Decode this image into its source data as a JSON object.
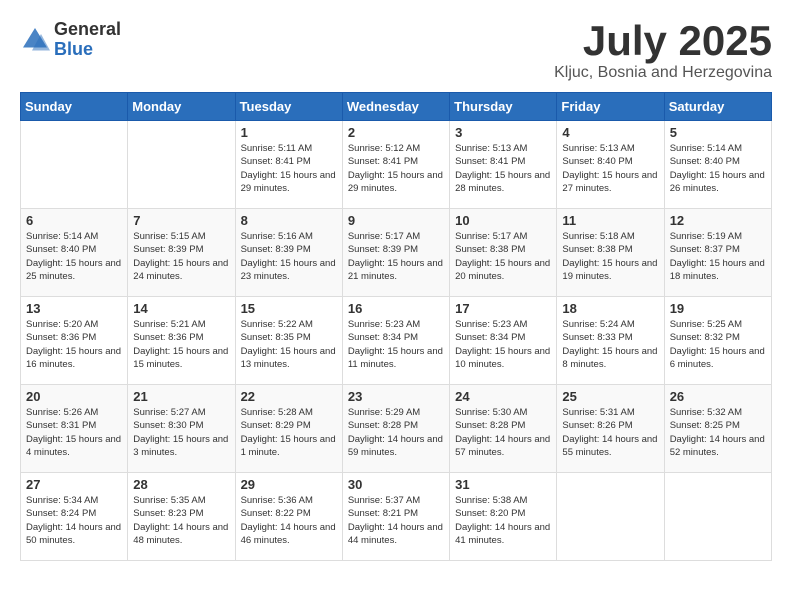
{
  "logo": {
    "general": "General",
    "blue": "Blue"
  },
  "header": {
    "month": "July 2025",
    "location": "Kljuc, Bosnia and Herzegovina"
  },
  "weekdays": [
    "Sunday",
    "Monday",
    "Tuesday",
    "Wednesday",
    "Thursday",
    "Friday",
    "Saturday"
  ],
  "weeks": [
    [
      {
        "day": "",
        "sunrise": "",
        "sunset": "",
        "daylight": ""
      },
      {
        "day": "",
        "sunrise": "",
        "sunset": "",
        "daylight": ""
      },
      {
        "day": "1",
        "sunrise": "Sunrise: 5:11 AM",
        "sunset": "Sunset: 8:41 PM",
        "daylight": "Daylight: 15 hours and 29 minutes."
      },
      {
        "day": "2",
        "sunrise": "Sunrise: 5:12 AM",
        "sunset": "Sunset: 8:41 PM",
        "daylight": "Daylight: 15 hours and 29 minutes."
      },
      {
        "day": "3",
        "sunrise": "Sunrise: 5:13 AM",
        "sunset": "Sunset: 8:41 PM",
        "daylight": "Daylight: 15 hours and 28 minutes."
      },
      {
        "day": "4",
        "sunrise": "Sunrise: 5:13 AM",
        "sunset": "Sunset: 8:40 PM",
        "daylight": "Daylight: 15 hours and 27 minutes."
      },
      {
        "day": "5",
        "sunrise": "Sunrise: 5:14 AM",
        "sunset": "Sunset: 8:40 PM",
        "daylight": "Daylight: 15 hours and 26 minutes."
      }
    ],
    [
      {
        "day": "6",
        "sunrise": "Sunrise: 5:14 AM",
        "sunset": "Sunset: 8:40 PM",
        "daylight": "Daylight: 15 hours and 25 minutes."
      },
      {
        "day": "7",
        "sunrise": "Sunrise: 5:15 AM",
        "sunset": "Sunset: 8:39 PM",
        "daylight": "Daylight: 15 hours and 24 minutes."
      },
      {
        "day": "8",
        "sunrise": "Sunrise: 5:16 AM",
        "sunset": "Sunset: 8:39 PM",
        "daylight": "Daylight: 15 hours and 23 minutes."
      },
      {
        "day": "9",
        "sunrise": "Sunrise: 5:17 AM",
        "sunset": "Sunset: 8:39 PM",
        "daylight": "Daylight: 15 hours and 21 minutes."
      },
      {
        "day": "10",
        "sunrise": "Sunrise: 5:17 AM",
        "sunset": "Sunset: 8:38 PM",
        "daylight": "Daylight: 15 hours and 20 minutes."
      },
      {
        "day": "11",
        "sunrise": "Sunrise: 5:18 AM",
        "sunset": "Sunset: 8:38 PM",
        "daylight": "Daylight: 15 hours and 19 minutes."
      },
      {
        "day": "12",
        "sunrise": "Sunrise: 5:19 AM",
        "sunset": "Sunset: 8:37 PM",
        "daylight": "Daylight: 15 hours and 18 minutes."
      }
    ],
    [
      {
        "day": "13",
        "sunrise": "Sunrise: 5:20 AM",
        "sunset": "Sunset: 8:36 PM",
        "daylight": "Daylight: 15 hours and 16 minutes."
      },
      {
        "day": "14",
        "sunrise": "Sunrise: 5:21 AM",
        "sunset": "Sunset: 8:36 PM",
        "daylight": "Daylight: 15 hours and 15 minutes."
      },
      {
        "day": "15",
        "sunrise": "Sunrise: 5:22 AM",
        "sunset": "Sunset: 8:35 PM",
        "daylight": "Daylight: 15 hours and 13 minutes."
      },
      {
        "day": "16",
        "sunrise": "Sunrise: 5:23 AM",
        "sunset": "Sunset: 8:34 PM",
        "daylight": "Daylight: 15 hours and 11 minutes."
      },
      {
        "day": "17",
        "sunrise": "Sunrise: 5:23 AM",
        "sunset": "Sunset: 8:34 PM",
        "daylight": "Daylight: 15 hours and 10 minutes."
      },
      {
        "day": "18",
        "sunrise": "Sunrise: 5:24 AM",
        "sunset": "Sunset: 8:33 PM",
        "daylight": "Daylight: 15 hours and 8 minutes."
      },
      {
        "day": "19",
        "sunrise": "Sunrise: 5:25 AM",
        "sunset": "Sunset: 8:32 PM",
        "daylight": "Daylight: 15 hours and 6 minutes."
      }
    ],
    [
      {
        "day": "20",
        "sunrise": "Sunrise: 5:26 AM",
        "sunset": "Sunset: 8:31 PM",
        "daylight": "Daylight: 15 hours and 4 minutes."
      },
      {
        "day": "21",
        "sunrise": "Sunrise: 5:27 AM",
        "sunset": "Sunset: 8:30 PM",
        "daylight": "Daylight: 15 hours and 3 minutes."
      },
      {
        "day": "22",
        "sunrise": "Sunrise: 5:28 AM",
        "sunset": "Sunset: 8:29 PM",
        "daylight": "Daylight: 15 hours and 1 minute."
      },
      {
        "day": "23",
        "sunrise": "Sunrise: 5:29 AM",
        "sunset": "Sunset: 8:28 PM",
        "daylight": "Daylight: 14 hours and 59 minutes."
      },
      {
        "day": "24",
        "sunrise": "Sunrise: 5:30 AM",
        "sunset": "Sunset: 8:28 PM",
        "daylight": "Daylight: 14 hours and 57 minutes."
      },
      {
        "day": "25",
        "sunrise": "Sunrise: 5:31 AM",
        "sunset": "Sunset: 8:26 PM",
        "daylight": "Daylight: 14 hours and 55 minutes."
      },
      {
        "day": "26",
        "sunrise": "Sunrise: 5:32 AM",
        "sunset": "Sunset: 8:25 PM",
        "daylight": "Daylight: 14 hours and 52 minutes."
      }
    ],
    [
      {
        "day": "27",
        "sunrise": "Sunrise: 5:34 AM",
        "sunset": "Sunset: 8:24 PM",
        "daylight": "Daylight: 14 hours and 50 minutes."
      },
      {
        "day": "28",
        "sunrise": "Sunrise: 5:35 AM",
        "sunset": "Sunset: 8:23 PM",
        "daylight": "Daylight: 14 hours and 48 minutes."
      },
      {
        "day": "29",
        "sunrise": "Sunrise: 5:36 AM",
        "sunset": "Sunset: 8:22 PM",
        "daylight": "Daylight: 14 hours and 46 minutes."
      },
      {
        "day": "30",
        "sunrise": "Sunrise: 5:37 AM",
        "sunset": "Sunset: 8:21 PM",
        "daylight": "Daylight: 14 hours and 44 minutes."
      },
      {
        "day": "31",
        "sunrise": "Sunrise: 5:38 AM",
        "sunset": "Sunset: 8:20 PM",
        "daylight": "Daylight: 14 hours and 41 minutes."
      },
      {
        "day": "",
        "sunrise": "",
        "sunset": "",
        "daylight": ""
      },
      {
        "day": "",
        "sunrise": "",
        "sunset": "",
        "daylight": ""
      }
    ]
  ]
}
